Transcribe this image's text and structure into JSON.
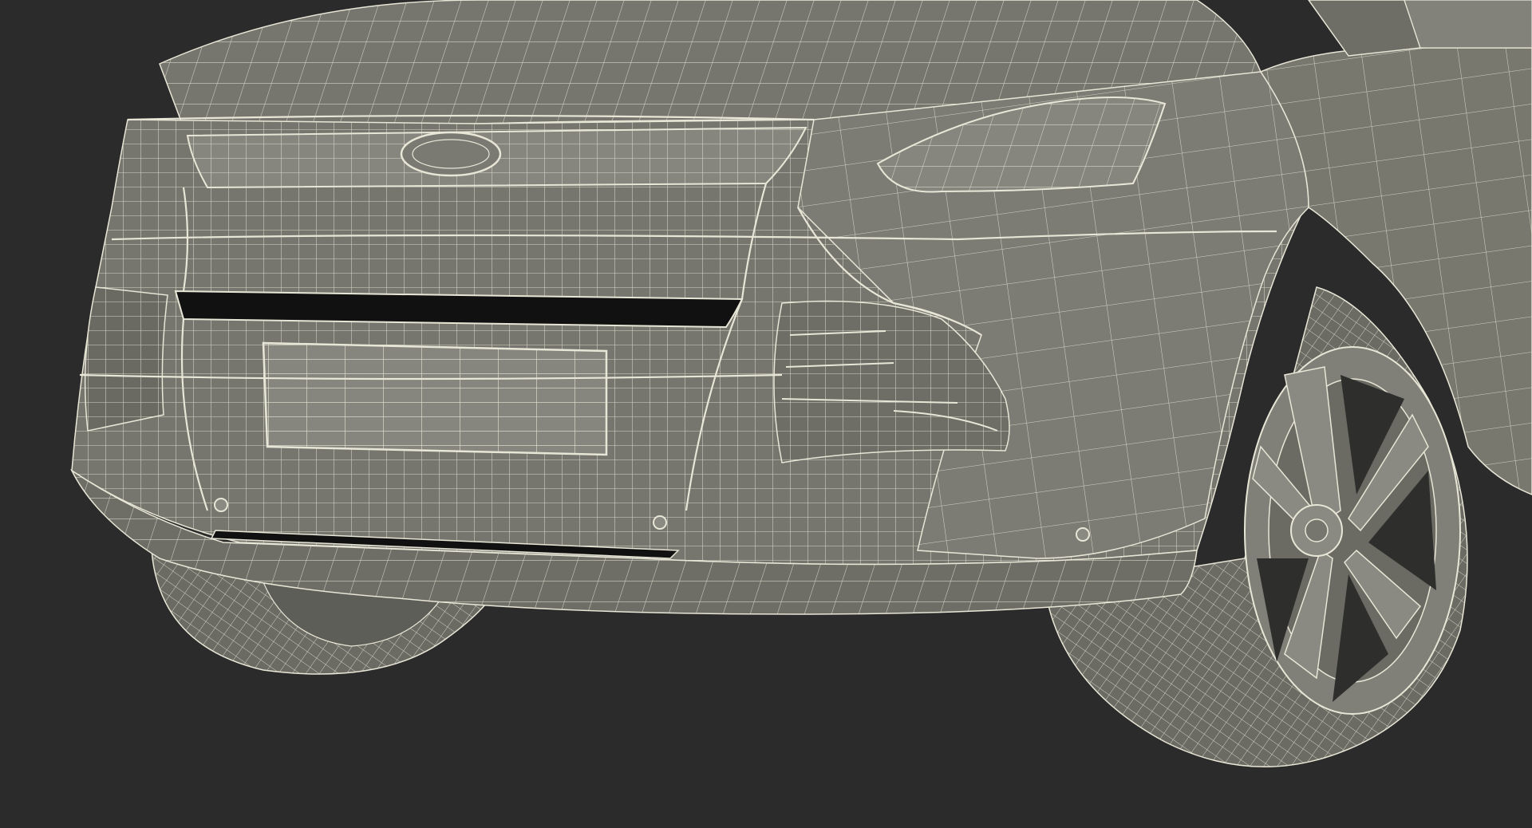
{
  "scene": {
    "subject": "wireframe-vehicle-front",
    "colors": {
      "background": "#2b2b2b",
      "body": "#76766f",
      "body_dark": "#5e5e58",
      "body_light": "#86867e",
      "wire": "#e8e6d6",
      "opening": "#111111",
      "tire": "#6b6b64",
      "rim": "#808078"
    }
  }
}
